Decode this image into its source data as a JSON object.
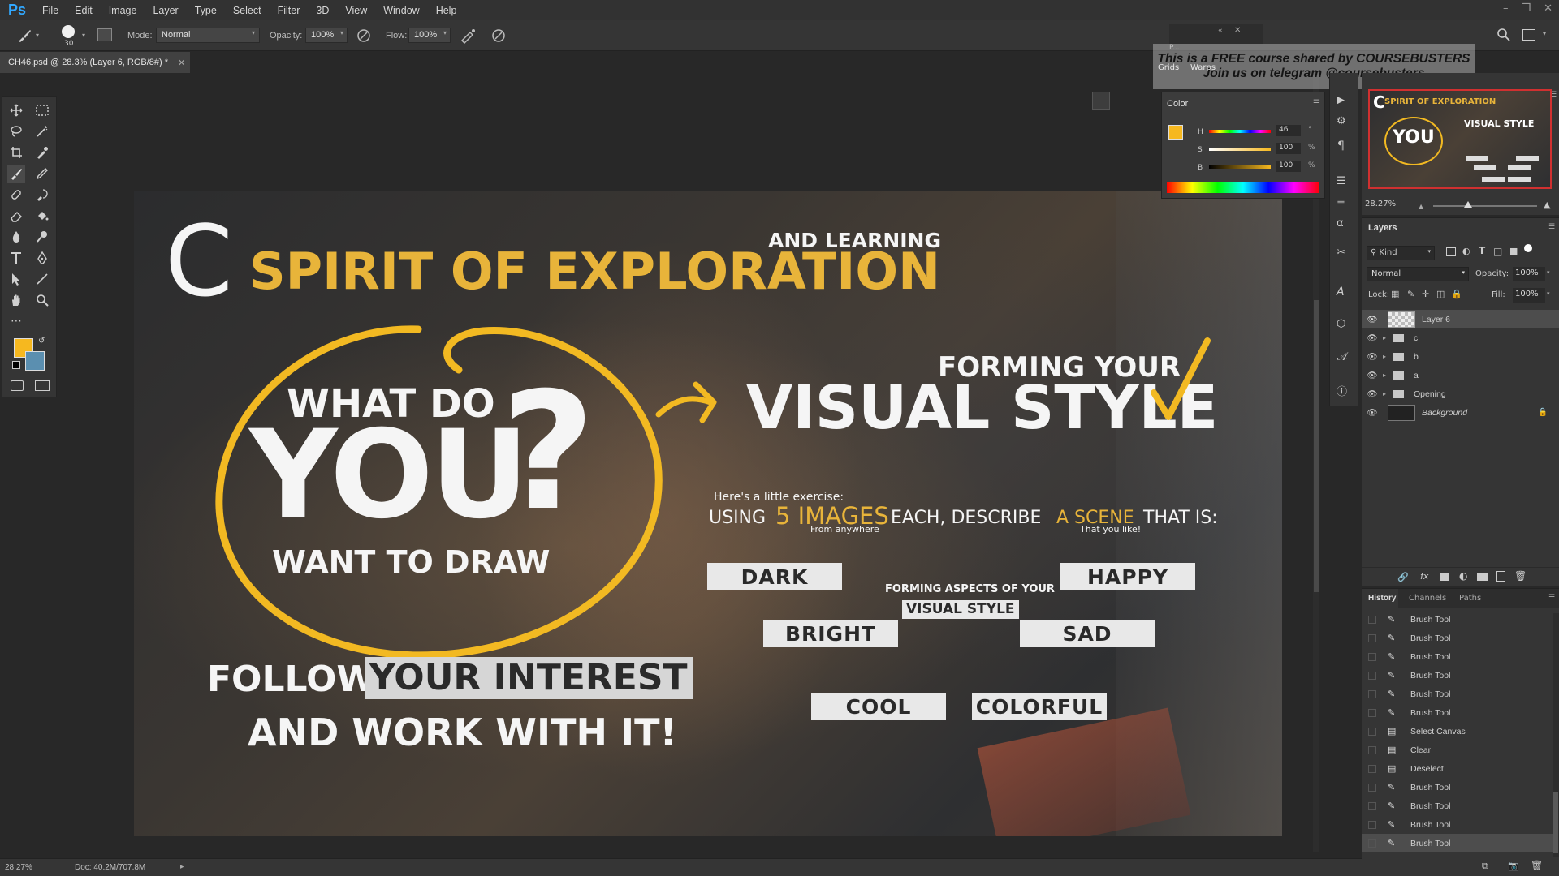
{
  "menubar": {
    "logo": "Ps",
    "items": [
      "File",
      "Edit",
      "Image",
      "Layer",
      "Type",
      "Select",
      "Filter",
      "3D",
      "View",
      "Window",
      "Help"
    ]
  },
  "options": {
    "brush_size": "30",
    "mode_label": "Mode:",
    "mode_value": "Normal",
    "opacity_label": "Opacity:",
    "opacity_value": "100%",
    "flow_label": "Flow:",
    "flow_value": "100%"
  },
  "document_tab": {
    "title": "CH46.psd @ 28.3% (Layer 6, RGB/8#) *"
  },
  "foreground_color": "#f6b81f",
  "background_color": "#5b8fb0",
  "color_panel": {
    "title": "Color",
    "h_label": "H",
    "h_value": "46",
    "h_unit": "°",
    "s_label": "S",
    "s_value": "100",
    "s_unit": "%",
    "b_label": "B",
    "b_value": "100",
    "b_unit": "%"
  },
  "watermark": {
    "line1": "This is a FREE course shared by COURSEBUSTERS",
    "line2": "Join us on telegram  @coursebusters"
  },
  "floating_tabs": {
    "p": "P...",
    "grids": "Grids",
    "warps": "Warps"
  },
  "artwork": {
    "c_letter": "C",
    "and_learning": "AND LEARNING",
    "spirit": "SPIRIT OF EXPLORATION",
    "what_do": "WHAT DO",
    "you": "YOU",
    "question": "?",
    "want_to_draw": "WANT TO DRAW",
    "follow": "FOLLOW",
    "your_interest": "YOUR INTEREST",
    "work_with_it": "AND WORK WITH IT!",
    "forming_your": "FORMING YOUR",
    "visual_style": "VISUAL STYLE",
    "exercise_intro": "Here's a little exercise:",
    "using": "USING",
    "five_images": "5 IMAGES",
    "each_describe": "EACH, DESCRIBE",
    "a_scene": "A SCENE",
    "that_is": "THAT IS:",
    "from_anywhere": "From anywhere",
    "that_you_like": "That you like!",
    "forming_aspects": "FORMING ASPECTS OF YOUR",
    "visual_style_small": "VISUAL STYLE",
    "moods": {
      "dark": "DARK",
      "happy": "HAPPY",
      "bright": "BRIGHT",
      "sad": "SAD",
      "cool": "COOL",
      "colorful": "COLORFUL"
    }
  },
  "navigator": {
    "zoom": "28.27%",
    "thumb_title": "SPIRIT OF EXPLORATION",
    "thumb_c": "C",
    "thumb_you": "YOU",
    "thumb_visual": "VISUAL STYLE"
  },
  "layers": {
    "title": "Layers",
    "kind": "Kind",
    "blend_mode": "Normal",
    "opacity_label": "Opacity:",
    "opacity_value": "100%",
    "lock_label": "Lock:",
    "fill_label": "Fill:",
    "fill_value": "100%",
    "items": [
      {
        "name": "Layer 6"
      },
      {
        "name": "c"
      },
      {
        "name": "b"
      },
      {
        "name": "a"
      },
      {
        "name": "Opening"
      },
      {
        "name": "Background"
      }
    ]
  },
  "history": {
    "tabs": [
      "History",
      "Channels",
      "Paths"
    ],
    "items": [
      {
        "label": "Brush Tool",
        "icon": "brush-icon"
      },
      {
        "label": "Brush Tool",
        "icon": "brush-icon"
      },
      {
        "label": "Brush Tool",
        "icon": "brush-icon"
      },
      {
        "label": "Brush Tool",
        "icon": "brush-icon"
      },
      {
        "label": "Brush Tool",
        "icon": "brush-icon"
      },
      {
        "label": "Brush Tool",
        "icon": "brush-icon"
      },
      {
        "label": "Select Canvas",
        "icon": "document-icon"
      },
      {
        "label": "Clear",
        "icon": "document-icon"
      },
      {
        "label": "Deselect",
        "icon": "document-icon"
      },
      {
        "label": "Brush Tool",
        "icon": "brush-icon"
      },
      {
        "label": "Brush Tool",
        "icon": "brush-icon"
      },
      {
        "label": "Brush Tool",
        "icon": "brush-icon"
      },
      {
        "label": "Brush Tool",
        "icon": "brush-icon"
      }
    ]
  },
  "status": {
    "zoom": "28.27%",
    "doc": "Doc: 40.2M/707.8M"
  }
}
